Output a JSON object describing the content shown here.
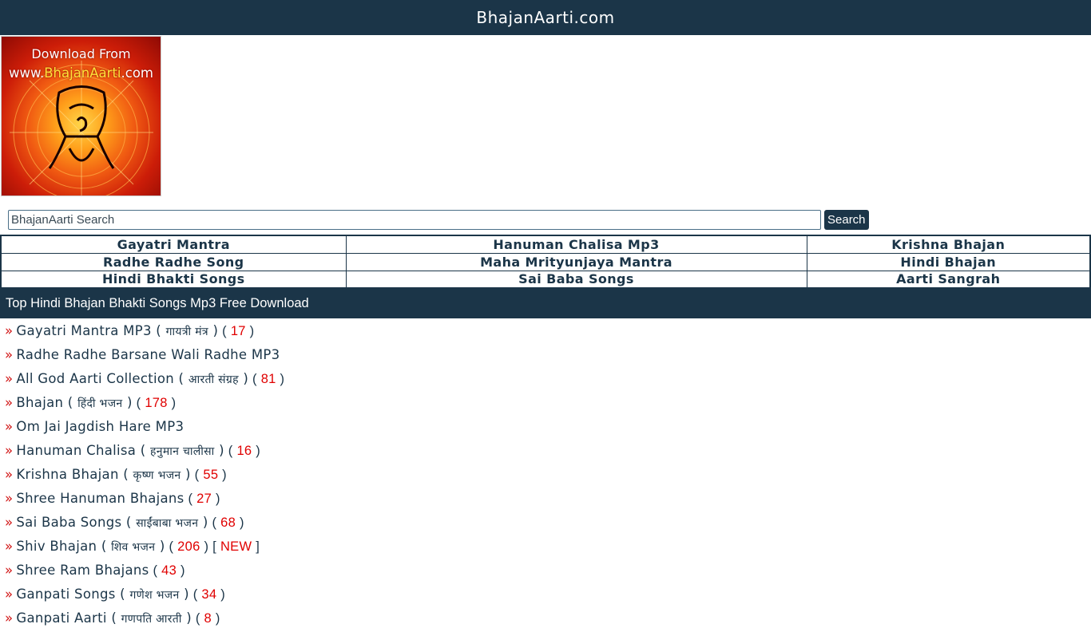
{
  "site": {
    "title": "BhajanAarti.com"
  },
  "logo": {
    "line1": "Download From",
    "line2_prefix": "www.",
    "line2_highlight": "BhajanAarti",
    "line2_suffix": ".com"
  },
  "search": {
    "placeholder": "BhajanAarti Search",
    "value": "",
    "button_label": "Search"
  },
  "nav": {
    "rows": [
      [
        "Gayatri Mantra",
        "Hanuman Chalisa Mp3",
        "Krishna Bhajan"
      ],
      [
        "Radhe Radhe Song",
        "Maha Mrityunjaya Mantra",
        "Hindi Bhajan"
      ],
      [
        "Hindi Bhakti Songs",
        "Sai Baba Songs",
        "Aarti Sangrah"
      ]
    ]
  },
  "section": {
    "heading": "Top Hindi Bhajan Bhakti Songs Mp3 Free Download"
  },
  "list": [
    {
      "title": "Gayatri Mantra MP3",
      "hindi": "गायत्री मंत्र",
      "count": "17",
      "new": ""
    },
    {
      "title": "Radhe Radhe Barsane Wali Radhe MP3",
      "hindi": "",
      "count": "",
      "new": ""
    },
    {
      "title": "All God Aarti Collection",
      "hindi": "आरती संग्रह",
      "count": "81",
      "new": ""
    },
    {
      "title": "Bhajan",
      "hindi": "हिंदी भजन",
      "count": "178",
      "new": ""
    },
    {
      "title": "Om Jai Jagdish Hare MP3",
      "hindi": "",
      "count": "",
      "new": ""
    },
    {
      "title": "Hanuman Chalisa",
      "hindi": "हनुमान चालीसा",
      "count": "16",
      "new": ""
    },
    {
      "title": "Krishna Bhajan",
      "hindi": "कृष्ण भजन",
      "count": "55",
      "new": ""
    },
    {
      "title": "Shree Hanuman Bhajans",
      "hindi": "",
      "count": "27",
      "new": ""
    },
    {
      "title": "Sai Baba Songs",
      "hindi": "साईंबाबा भजन",
      "count": "68",
      "new": ""
    },
    {
      "title": "Shiv Bhajan",
      "hindi": "शिव भजन",
      "count": "206",
      "new": "NEW"
    },
    {
      "title": "Shree Ram Bhajans",
      "hindi": "",
      "count": "43",
      "new": ""
    },
    {
      "title": "Ganpati Songs",
      "hindi": "गणेश भजन",
      "count": "34",
      "new": ""
    },
    {
      "title": "Ganpati Aarti",
      "hindi": "गणपति आरती",
      "count": "8",
      "new": ""
    }
  ],
  "colors": {
    "header_bg": "#1b3548",
    "accent_red": "#e00000"
  }
}
